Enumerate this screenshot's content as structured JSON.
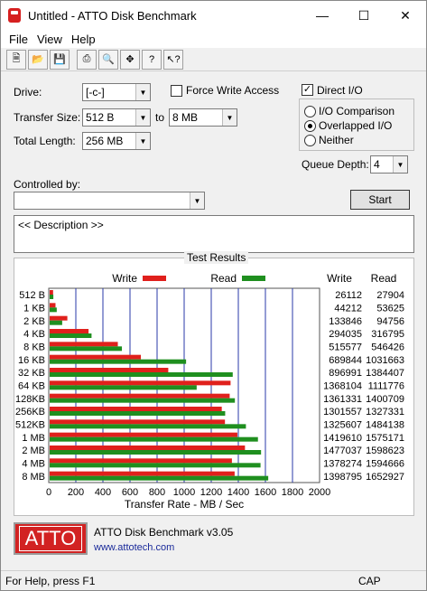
{
  "window": {
    "title": "Untitled - ATTO Disk Benchmark"
  },
  "menu": [
    "File",
    "View",
    "Help"
  ],
  "form": {
    "drive_label": "Drive:",
    "drive_value": "[-c-]",
    "transfer_size_label": "Transfer Size:",
    "transfer_from": "512 B",
    "to_label": "to",
    "transfer_to": "8 MB",
    "total_length_label": "Total Length:",
    "total_length": "256 MB",
    "force_write_label": "Force Write Access",
    "direct_io_label": "Direct I/O",
    "io_comparison_label": "I/O Comparison",
    "overlapped_io_label": "Overlapped I/O",
    "neither_label": "Neither",
    "queue_depth_label": "Queue Depth:",
    "queue_depth": "4",
    "controlled_by_label": "Controlled by:",
    "start_label": "Start",
    "description": "<< Description >>"
  },
  "results": {
    "title": "Test Results",
    "legend_write": "Write",
    "legend_read": "Read",
    "col_write": "Write",
    "col_read": "Read",
    "write_color": "#e0201c",
    "read_color": "#1f8f1f"
  },
  "chart_data": {
    "type": "bar",
    "xlabel": "Transfer Rate - MB / Sec",
    "xlim": [
      0,
      2000
    ],
    "xticks": [
      "0",
      "200",
      "400",
      "600",
      "800",
      "1000",
      "1200",
      "1400",
      "1600",
      "1800",
      "2000"
    ],
    "categories": [
      "512 B",
      "1 KB",
      "2 KB",
      "4 KB",
      "8 KB",
      "16 KB",
      "32 KB",
      "64 KB",
      "128KB",
      "256KB",
      "512KB",
      "1 MB",
      "2 MB",
      "4 MB",
      "8 MB"
    ],
    "series": [
      {
        "name": "Write",
        "values_kb": [
          26112,
          44212,
          133846,
          294035,
          515577,
          689844,
          896991,
          1368104,
          1361331,
          1301557,
          1325607,
          1419610,
          1477037,
          1378274,
          1398795
        ]
      },
      {
        "name": "Read",
        "values_kb": [
          27904,
          53625,
          94756,
          316795,
          546426,
          1031663,
          1384407,
          1111776,
          1400709,
          1327331,
          1484138,
          1575171,
          1598623,
          1594666,
          1652927
        ]
      }
    ]
  },
  "footer": {
    "logo_text": "ATTO",
    "product": "ATTO Disk Benchmark v3.05",
    "url": "www.attotech.com"
  },
  "status": {
    "help": "For Help, press F1",
    "cap": "CAP"
  }
}
